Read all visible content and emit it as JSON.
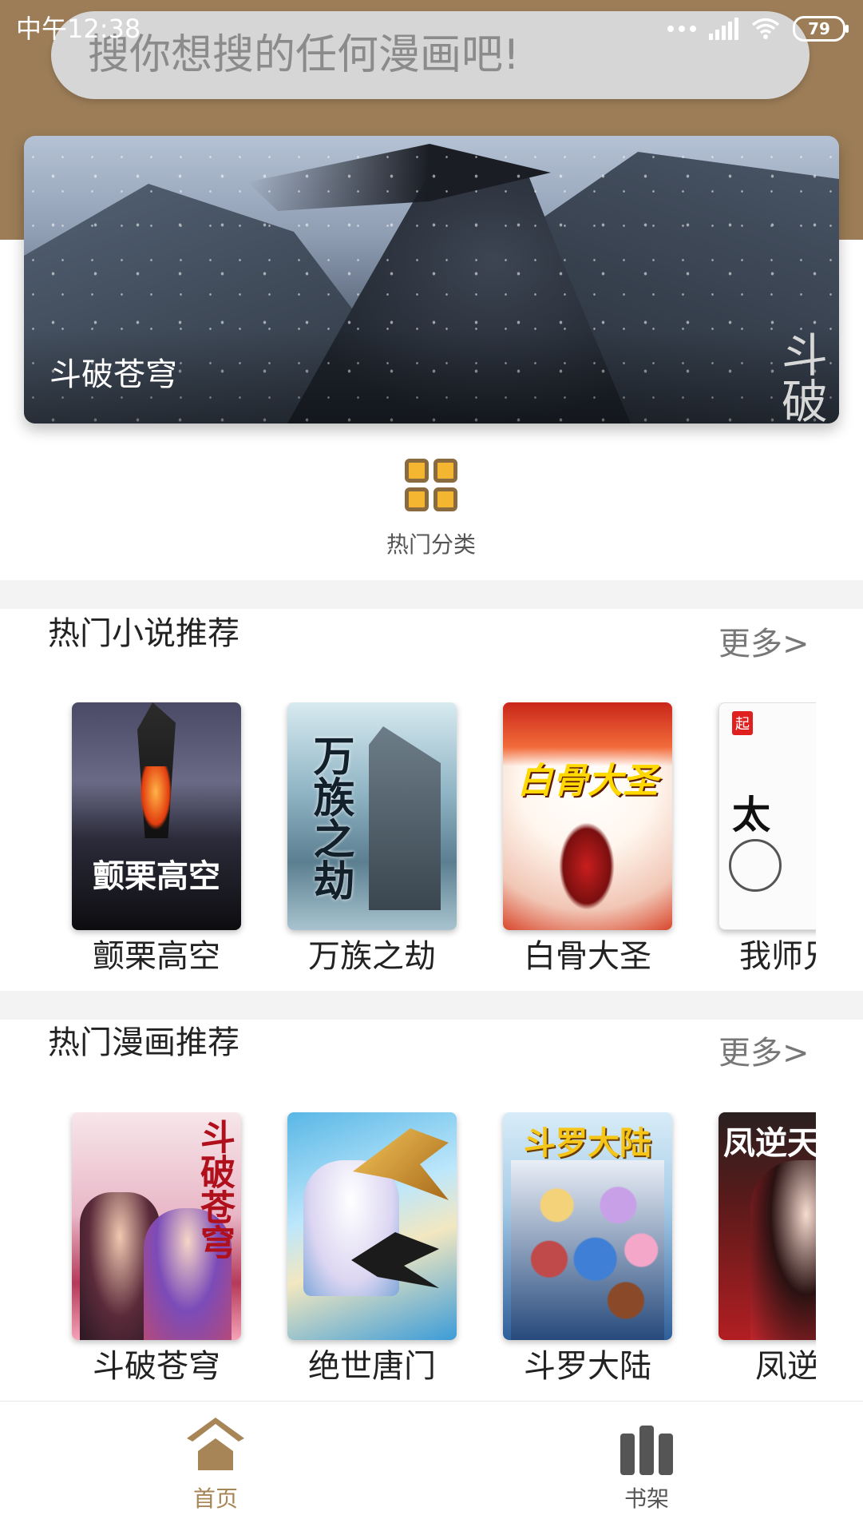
{
  "status_bar": {
    "time": "中午12:38",
    "battery": "79"
  },
  "search": {
    "placeholder": "搜你想搜的任何漫画吧!"
  },
  "banner": {
    "caption": "斗破苍穹",
    "cover_calligraphy": "斗破"
  },
  "category": {
    "label": "热门分类",
    "icon": "grid-icon"
  },
  "novels": {
    "title": "热门小说推荐",
    "more": "更多>",
    "items": [
      {
        "title": "颤栗高空",
        "cover_text": "颤栗高空"
      },
      {
        "title": "万族之劫",
        "cover_text": "万族之劫"
      },
      {
        "title": "白骨大圣",
        "cover_text": "白骨大圣"
      },
      {
        "title": "我师兄实",
        "cover_text": "太"
      }
    ]
  },
  "comics": {
    "title": "热门漫画推荐",
    "more": "更多>",
    "items": [
      {
        "title": "斗破苍穹",
        "cover_text": "斗破苍穹"
      },
      {
        "title": "绝世唐门"
      },
      {
        "title": "斗罗大陆",
        "cover_text": "斗罗大陆"
      },
      {
        "title": "凤逆天",
        "cover_text": "凤逆天"
      }
    ]
  },
  "bottom_nav": [
    {
      "label": "首页",
      "icon": "home-icon",
      "color": "#a88556"
    },
    {
      "label": "书架",
      "icon": "bookshelf-icon",
      "color": "#555555"
    }
  ],
  "colors": {
    "header_brown": "#9c7d58",
    "accent": "#a88556"
  }
}
